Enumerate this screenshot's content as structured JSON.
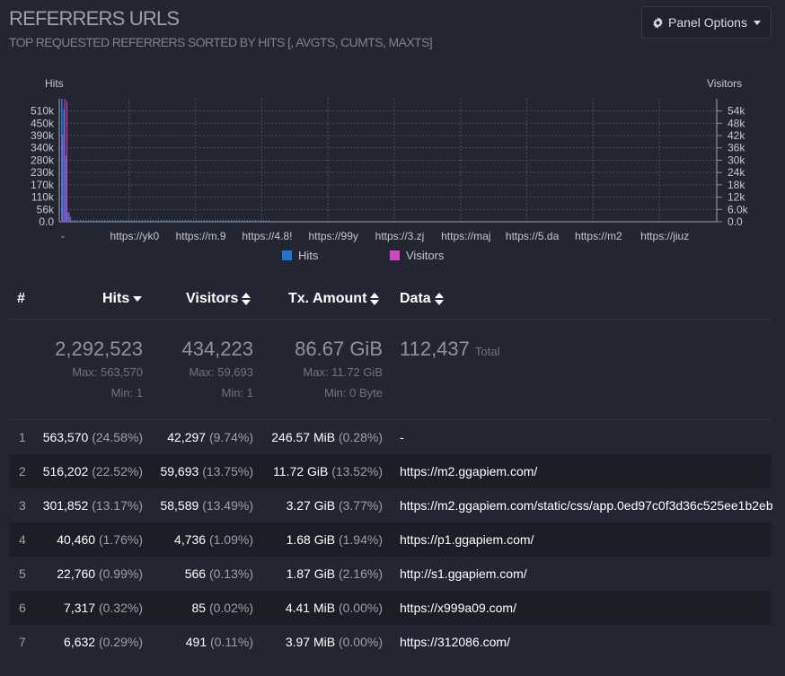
{
  "header": {
    "title": "REFERRERS URLS",
    "subtitle": "TOP REQUESTED REFERRERS SORTED BY HITS [, AVGTS, CUMTS, MAXTS]",
    "panel_options_label": "Panel Options",
    "panel_options_icon": "gear-icon"
  },
  "chart_data": {
    "type": "bar",
    "y_left_label": "Hits",
    "y_right_label": "Visitors",
    "y_left_ticks": [
      "510k",
      "450k",
      "390k",
      "340k",
      "280k",
      "230k",
      "170k",
      "110k",
      "56k",
      "0.0"
    ],
    "y_right_ticks": [
      "54k",
      "48k",
      "42k",
      "36k",
      "30k",
      "24k",
      "18k",
      "12k",
      "6.0k",
      "0.0"
    ],
    "ylim_left": [
      0,
      563570
    ],
    "ylim_right": [
      0,
      59693
    ],
    "x_tick_labels": [
      "-",
      "https://yk0",
      "https://m.9",
      "https://4.8!",
      "https://99y",
      "https://3.zj",
      "https://maj",
      "https://5.da",
      "https://m2",
      "https://jiuz"
    ],
    "series": [
      {
        "name": "Hits",
        "color": "#1f77d0",
        "values": [
          563570,
          516202,
          301852,
          40460,
          22760,
          7317,
          6632
        ]
      },
      {
        "name": "Visitors",
        "color": "#d147c3",
        "values": [
          42297,
          59693,
          58589,
          4736,
          566,
          85,
          491
        ]
      }
    ],
    "grid": true,
    "legend_position": "bottom"
  },
  "legend": [
    {
      "label": "Hits",
      "color": "#1f77d0"
    },
    {
      "label": "Visitors",
      "color": "#d147c3"
    }
  ],
  "table": {
    "headers": {
      "index": "#",
      "hits": "Hits",
      "visitors": "Visitors",
      "tx": "Tx. Amount",
      "data": "Data"
    },
    "summary": {
      "hits_total": "2,292,523",
      "hits_max": "Max: 563,570",
      "hits_min": "Min: 1",
      "visitors_total": "434,223",
      "visitors_max": "Max: 59,693",
      "visitors_min": "Min: 1",
      "tx_total": "86.67 GiB",
      "tx_max": "Max: 11.72 GiB",
      "tx_min": "Min: 0 Byte",
      "data_total": "112,437",
      "data_total_label": "Total"
    },
    "rows": [
      {
        "index": "1",
        "hits": "563,570",
        "hits_pct": "(24.58%)",
        "visitors": "42,297",
        "visitors_pct": "(9.74%)",
        "tx": "246.57 MiB",
        "tx_pct": "(0.28%)",
        "data": "-"
      },
      {
        "index": "2",
        "hits": "516,202",
        "hits_pct": "(22.52%)",
        "visitors": "59,693",
        "visitors_pct": "(13.75%)",
        "tx": "11.72 GiB",
        "tx_pct": "(13.52%)",
        "data": "https://m2.ggapiem.com/"
      },
      {
        "index": "3",
        "hits": "301,852",
        "hits_pct": "(13.17%)",
        "visitors": "58,589",
        "visitors_pct": "(13.49%)",
        "tx": "3.27 GiB",
        "tx_pct": "(3.77%)",
        "data": "https://m2.ggapiem.com/static/css/app.0ed97c0f3d36c525ee1b2eb"
      },
      {
        "index": "4",
        "hits": "40,460",
        "hits_pct": "(1.76%)",
        "visitors": "4,736",
        "visitors_pct": "(1.09%)",
        "tx": "1.68 GiB",
        "tx_pct": "(1.94%)",
        "data": "https://p1.ggapiem.com/"
      },
      {
        "index": "5",
        "hits": "22,760",
        "hits_pct": "(0.99%)",
        "visitors": "566",
        "visitors_pct": "(0.13%)",
        "tx": "1.87 GiB",
        "tx_pct": "(2.16%)",
        "data": "http://s1.ggapiem.com/"
      },
      {
        "index": "6",
        "hits": "7,317",
        "hits_pct": "(0.32%)",
        "visitors": "85",
        "visitors_pct": "(0.02%)",
        "tx": "4.41 MiB",
        "tx_pct": "(0.00%)",
        "data": "https://x999a09.com/"
      },
      {
        "index": "7",
        "hits": "6,632",
        "hits_pct": "(0.29%)",
        "visitors": "491",
        "visitors_pct": "(0.11%)",
        "tx": "3.97 MiB",
        "tx_pct": "(0.00%)",
        "data": "https://312086.com/"
      }
    ]
  }
}
